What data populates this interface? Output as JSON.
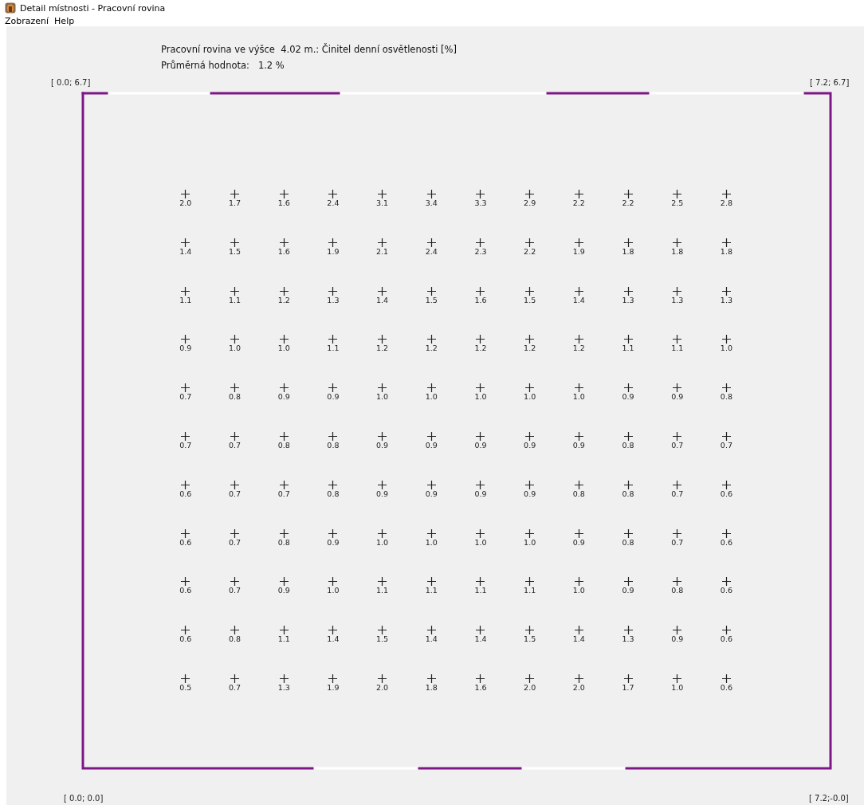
{
  "window": {
    "title": "Detail místnosti - Pracovní rovina"
  },
  "menu": [
    {
      "label": "Zobrazení"
    },
    {
      "label": "Help"
    }
  ],
  "heading": "Pracovní rovina ve výšce  4.02 m.: Činitel denní osvětlenosti [%]",
  "average": "Průměrná hodnota:   1.2 %",
  "corners": {
    "top_left": "[ 0.0; 6.7]",
    "top_right": "[ 7.2; 6.7]",
    "bottom_left": "[ 0.0; 0.0]",
    "bottom_right": "[ 7.2;-0.0]"
  },
  "grid_rows": [
    [
      "2.0",
      "1.7",
      "1.6",
      "2.4",
      "3.1",
      "3.4",
      "3.3",
      "2.9",
      "2.2",
      "2.2",
      "2.5",
      "2.8"
    ],
    [
      "1.4",
      "1.5",
      "1.6",
      "1.9",
      "2.1",
      "2.4",
      "2.3",
      "2.2",
      "1.9",
      "1.8",
      "1.8",
      "1.8"
    ],
    [
      "1.1",
      "1.1",
      "1.2",
      "1.3",
      "1.4",
      "1.5",
      "1.6",
      "1.5",
      "1.4",
      "1.3",
      "1.3",
      "1.3"
    ],
    [
      "0.9",
      "1.0",
      "1.0",
      "1.1",
      "1.2",
      "1.2",
      "1.2",
      "1.2",
      "1.2",
      "1.1",
      "1.1",
      "1.0"
    ],
    [
      "0.7",
      "0.8",
      "0.9",
      "0.9",
      "1.0",
      "1.0",
      "1.0",
      "1.0",
      "1.0",
      "0.9",
      "0.9",
      "0.8"
    ],
    [
      "0.7",
      "0.7",
      "0.8",
      "0.8",
      "0.9",
      "0.9",
      "0.9",
      "0.9",
      "0.9",
      "0.8",
      "0.7",
      "0.7"
    ],
    [
      "0.6",
      "0.7",
      "0.7",
      "0.8",
      "0.9",
      "0.9",
      "0.9",
      "0.9",
      "0.8",
      "0.8",
      "0.7",
      "0.6"
    ],
    [
      "0.6",
      "0.7",
      "0.8",
      "0.9",
      "1.0",
      "1.0",
      "1.0",
      "1.0",
      "0.9",
      "0.8",
      "0.7",
      "0.6"
    ],
    [
      "0.6",
      "0.7",
      "0.9",
      "1.0",
      "1.1",
      "1.1",
      "1.1",
      "1.1",
      "1.0",
      "0.9",
      "0.8",
      "0.6"
    ],
    [
      "0.6",
      "0.8",
      "1.1",
      "1.4",
      "1.5",
      "1.4",
      "1.4",
      "1.5",
      "1.4",
      "1.3",
      "0.9",
      "0.6"
    ],
    [
      "0.5",
      "0.7",
      "1.3",
      "1.9",
      "2.0",
      "1.8",
      "1.6",
      "2.0",
      "2.0",
      "1.7",
      "1.0",
      "0.6"
    ]
  ]
}
